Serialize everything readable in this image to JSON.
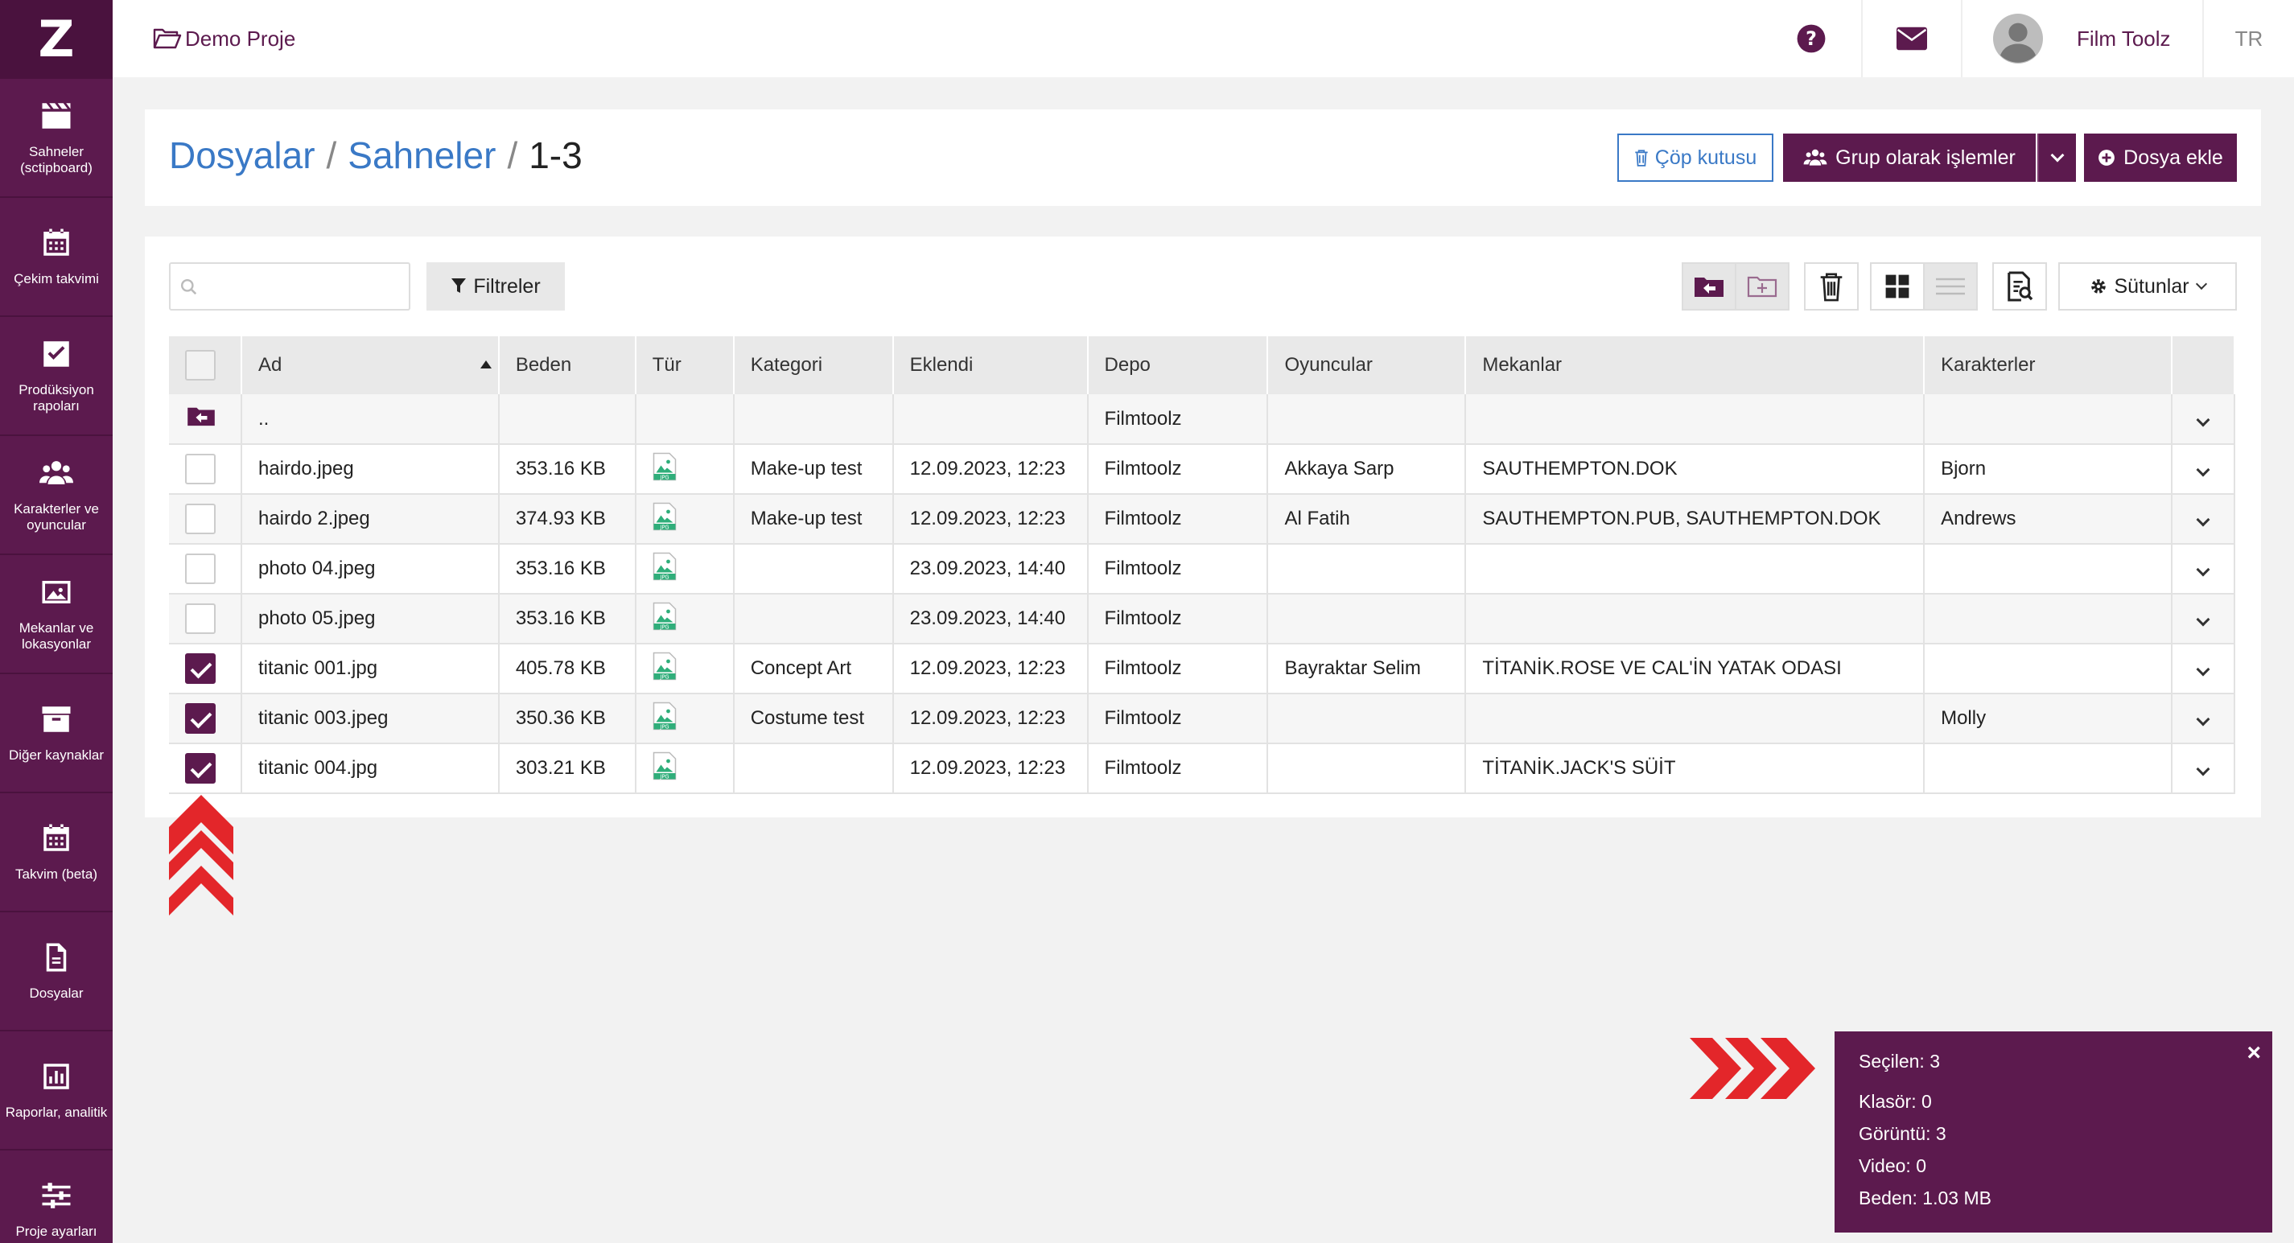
{
  "sidebar": {
    "logo": "Z",
    "items": [
      {
        "label": "Sahneler (sctipboard)",
        "icon": "clapperboard-icon"
      },
      {
        "label": "Çekim takvimi",
        "icon": "calendar-icon"
      },
      {
        "label": "Prodüksiyon rapoları",
        "icon": "check-square-icon"
      },
      {
        "label": "Karakterler ve oyuncular",
        "icon": "users-icon"
      },
      {
        "label": "Mekanlar ve lokasyonlar",
        "icon": "image-icon"
      },
      {
        "label": "Diğer kaynaklar",
        "icon": "archive-icon"
      },
      {
        "label": "Takvim (beta)",
        "icon": "calendar-grid-icon"
      },
      {
        "label": "Dosyalar",
        "icon": "file-icon"
      },
      {
        "label": "Raporlar, analitik",
        "icon": "bar-chart-icon"
      },
      {
        "label": "Proje ayarları",
        "icon": "sliders-icon"
      }
    ]
  },
  "topbar": {
    "project": "Demo Proje",
    "user": "Film Toolz",
    "lang": "TR"
  },
  "breadcrumb": {
    "dosyalar": "Dosyalar",
    "sahneler": "Sahneler",
    "current": "1-3",
    "sep": "/"
  },
  "header_buttons": {
    "trash": "Çöp kutusu",
    "group": "Grup olarak işlemler",
    "add": "Dosya ekle"
  },
  "toolbar": {
    "search_placeholder": "",
    "filters": "Filtreler",
    "columns": "Sütunlar"
  },
  "table": {
    "headers": [
      "Ad",
      "Beden",
      "Tür",
      "Kategori",
      "Eklendi",
      "Depo",
      "Oyuncular",
      "Mekanlar",
      "Karakterler"
    ],
    "parent_row": {
      "name": "..",
      "depo": "Filmtoolz"
    },
    "rows": [
      {
        "name": "hairdo.jpeg",
        "size": "353.16 KB",
        "type": "JPG",
        "category": "Make-up test",
        "added": "12.09.2023, 12:23",
        "depo": "Filmtoolz",
        "actors": "Akkaya Sarp",
        "locations": "SAUTHEMPTON.DOK",
        "characters": "Bjorn",
        "checked": false
      },
      {
        "name": "hairdo 2.jpeg",
        "size": "374.93 KB",
        "type": "JPG",
        "category": "Make-up test",
        "added": "12.09.2023, 12:23",
        "depo": "Filmtoolz",
        "actors": "Al Fatih",
        "locations": "SAUTHEMPTON.PUB, SAUTHEMPTON.DOK",
        "characters": "Andrews",
        "checked": false
      },
      {
        "name": "photo 04.jpeg",
        "size": "353.16 KB",
        "type": "JPG",
        "category": "",
        "added": "23.09.2023, 14:40",
        "depo": "Filmtoolz",
        "actors": "",
        "locations": "",
        "characters": "",
        "checked": false
      },
      {
        "name": "photo 05.jpeg",
        "size": "353.16 KB",
        "type": "JPG",
        "category": "",
        "added": "23.09.2023, 14:40",
        "depo": "Filmtoolz",
        "actors": "",
        "locations": "",
        "characters": "",
        "checked": false
      },
      {
        "name": "titanic 001.jpg",
        "size": "405.78 KB",
        "type": "JPG",
        "category": "Concept Art",
        "added": "12.09.2023, 12:23",
        "depo": "Filmtoolz",
        "actors": "Bayraktar Selim",
        "locations": "TİTANİK.ROSE VE CAL'İN YATAK ODASI",
        "characters": "",
        "checked": true
      },
      {
        "name": "titanic 003.jpeg",
        "size": "350.36 KB",
        "type": "JPG",
        "category": "Costume test",
        "added": "12.09.2023, 12:23",
        "depo": "Filmtoolz",
        "actors": "",
        "locations": "",
        "characters": "Molly",
        "checked": true
      },
      {
        "name": "titanic 004.jpg",
        "size": "303.21 KB",
        "type": "JPG",
        "category": "",
        "added": "12.09.2023, 12:23",
        "depo": "Filmtoolz",
        "actors": "",
        "locations": "TİTANİK.JACK'S SÜİT",
        "characters": "",
        "checked": true
      }
    ]
  },
  "selection": {
    "selected": "Seçilen: 3",
    "folders": "Klasör: 0",
    "images": "Görüntü: 3",
    "videos": "Video: 0",
    "size": "Beden: 1.03 MB"
  },
  "colors": {
    "brand": "#5c1a4e",
    "link": "#3a79c6",
    "annotation_red": "#e3262a",
    "jpg_green": "#2fae7a"
  }
}
